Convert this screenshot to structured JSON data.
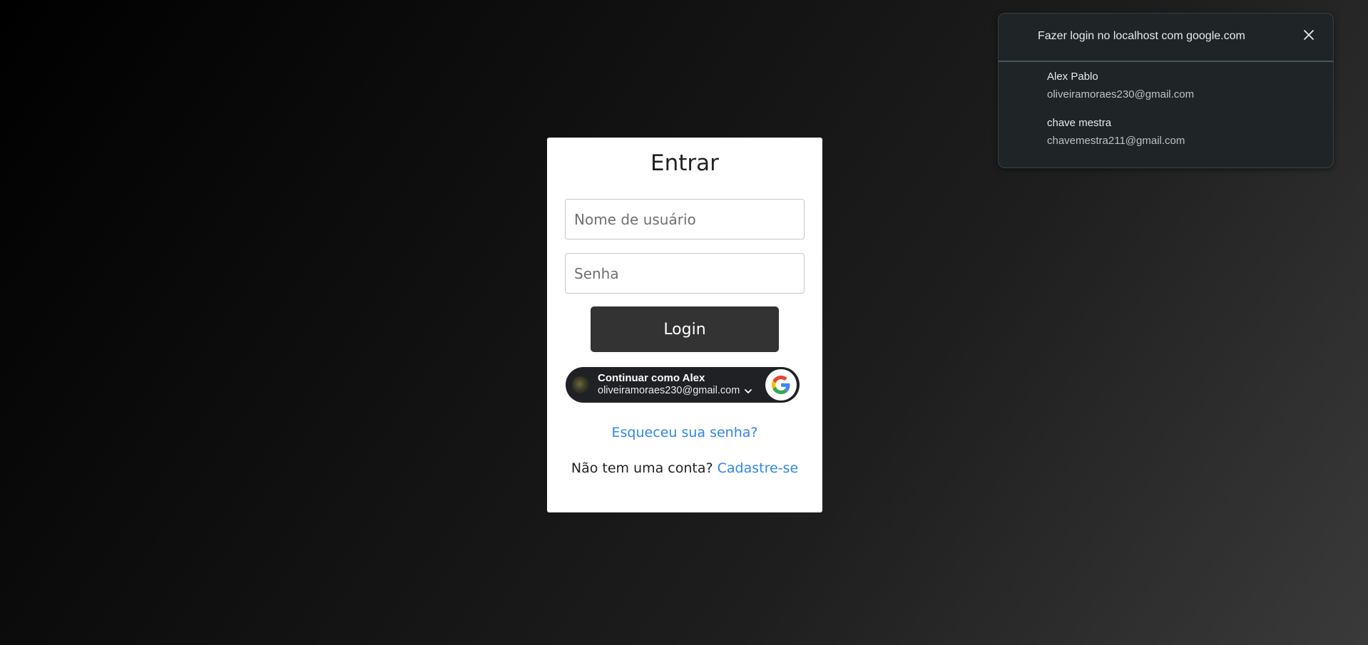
{
  "login_card": {
    "title": "Entrar",
    "username_placeholder": "Nome de usuário",
    "password_placeholder": "Senha",
    "login_label": "Login",
    "google_button": {
      "name_text": "Continuar como Alex",
      "email_text": "oliveiramoraes230@gmail.com"
    },
    "forgot_label": "Esqueceu sua senha?",
    "signup_prompt": "Não tem uma conta?",
    "signup_label": "Cadastre-se"
  },
  "google_popup": {
    "title": "Fazer login no localhost com google.com",
    "accounts": [
      {
        "name": "Alex Pablo",
        "email": "oliveiramoraes230@gmail.com"
      },
      {
        "name": "chave mestra",
        "email": "chavemestra211@gmail.com"
      }
    ]
  },
  "colors": {
    "link": "#2f86e8",
    "login_button": "#333333",
    "google_button_bg": "#202124",
    "popup_bg": "#1f2427"
  },
  "icons": {
    "close": "close-icon",
    "chevron": "chevron-down-icon",
    "google": "google-logo-icon",
    "avatar": "avatar"
  }
}
